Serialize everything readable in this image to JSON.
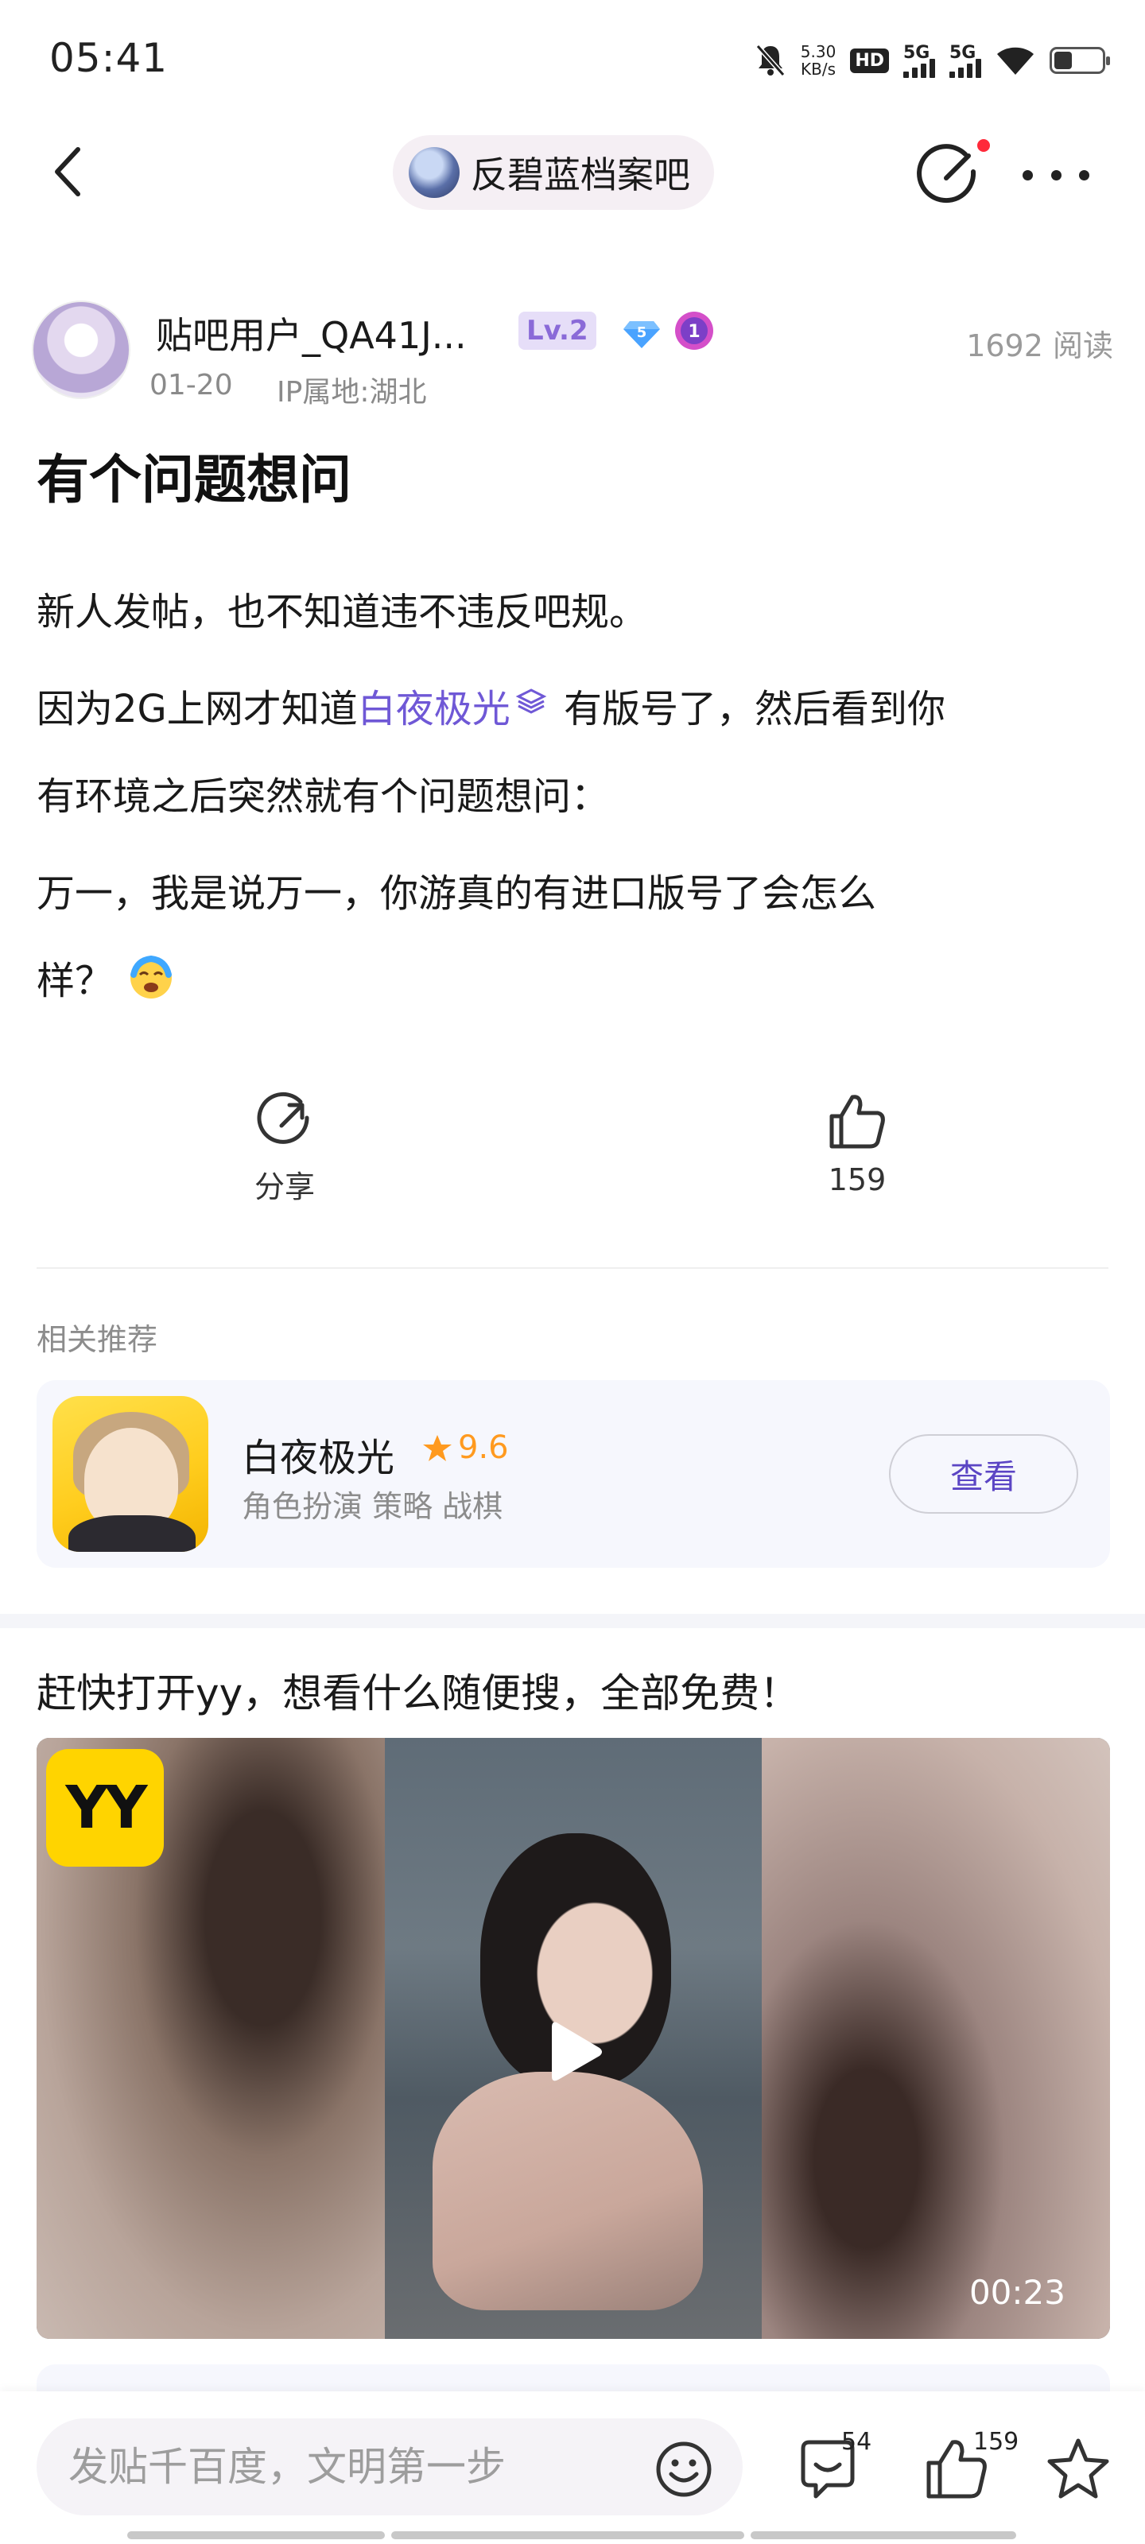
{
  "status_bar": {
    "time": "05:41",
    "net_speed_value": "5.30",
    "net_speed_unit": "KB/s",
    "hd_label": "HD",
    "sim1_label": "5G",
    "sim2_label": "5G",
    "battery_level": 0.34
  },
  "nav": {
    "forum_name": "反碧蓝档案吧"
  },
  "author": {
    "name": "贴吧用户_QA41J...",
    "level": "Lv.2",
    "diamond_level": "5",
    "medal_level": "1",
    "date": "01-20",
    "ip": "IP属地:湖北",
    "read_count": "1692 阅读"
  },
  "post": {
    "title": "有个问题想问",
    "line1": "新人发帖，也不知道违不违反吧规。",
    "line2_pre": " 因为2G上网才知道",
    "line2_link": "白夜极光",
    "line2_post": " 有版号了，然后看到你",
    "line3": "有环境之后突然就有个问题想问：",
    "line4": " 万一，我是说万一，你游真的有进口版号了会怎么",
    "line5": "样？"
  },
  "actions": {
    "share_label": "分享",
    "like_count": "159"
  },
  "related": {
    "title": "相关推荐",
    "app_name": "白夜极光",
    "rating": "9.6",
    "tags": "角色扮演 策略 战棋",
    "view_label": "查看"
  },
  "ad": {
    "title": "赶快打开yy，想看什么随便搜，全部免费！",
    "logo_text": "YY",
    "duration": "00:23"
  },
  "bottom_bar": {
    "input_placeholder": "发贴千百度，文明第一步",
    "comment_count": "54",
    "like_count": "159"
  },
  "colors": {
    "accent": "#6f58d6",
    "rating": "#ff9a1f",
    "notification": "#ff2a3a"
  }
}
